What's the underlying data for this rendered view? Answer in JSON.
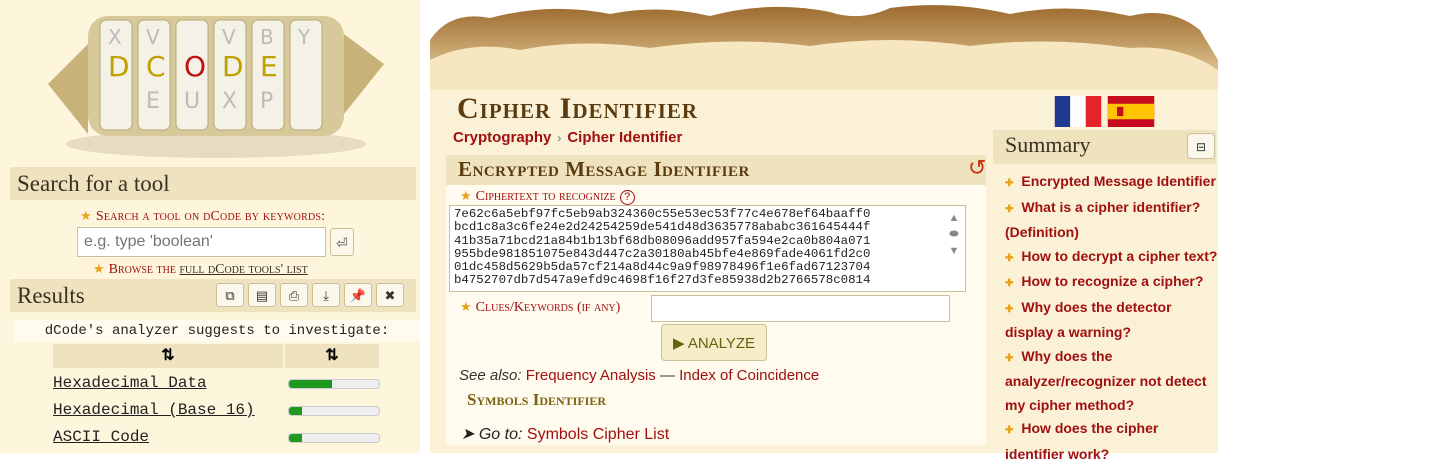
{
  "logo": {
    "text": "DCODE"
  },
  "sidebar": {
    "search_title": "Search for a tool",
    "search_label": "Search a tool on dCode by keywords:",
    "search_placeholder": "e.g. type 'boolean'",
    "browse_prefix": "Browse the",
    "browse_link": "full dCode tools' list",
    "results_title": "Results",
    "analyzer_note": "dCode's analyzer suggests to investigate:",
    "sort_a": "⇅",
    "sort_b": "⇅",
    "results": [
      {
        "name": "Hexadecimal Data",
        "score": 0.48
      },
      {
        "name": "Hexadecimal (Base 16)",
        "score": 0.14
      },
      {
        "name": "ASCII Code",
        "score": 0.14
      }
    ]
  },
  "page": {
    "title": "Cipher Identifier",
    "breadcrumb": [
      "Cryptography",
      "Cipher Identifier"
    ],
    "breadcrumb_sep": "›"
  },
  "tool": {
    "title": "Encrypted Message Identifier",
    "ciphertext_label": "Ciphertext to recognize",
    "ciphertext": "7e62c6a5ebf97fc5eb9ab324360c55e53ec53f77c4e678ef64baaff0\nbcd1c8a3c6fe24e2d24254259de541d48d3635778ababc361645444f\n41b35a71bcd21a84b1b13bf68db08096add957fa594e2ca0b804a071\n955bde981851075e843d447c2a30180ab45bfe4e869fade4061fd2c0\n01dc458d5629b5da57cf214a8d44c9a9f98978496f1e6fad67123704\nb4752707db7d547a9efd9c4698f16f27d3fe85938d2b2766578c0814",
    "clues_label": "Clues/Keywords (if any)",
    "analyze_label": "▶ ANALYZE",
    "see_also_label": "See also:",
    "see_also_links": [
      "Frequency Analysis",
      "Index of Coincidence"
    ],
    "see_also_sep": " — ",
    "symbols_title": "Symbols Identifier",
    "goto_label": "➤ Go to:",
    "goto_link": "Symbols Cipher List"
  },
  "summary": {
    "title": "Summary",
    "items": [
      "Encrypted Message Identifier",
      "What is a cipher identifier? (Definition)",
      "How to decrypt a cipher text?",
      "How to recognize a cipher?",
      "Why does the detector display a warning?",
      "Why does the analyzer/recognizer not detect my cipher method?",
      "How does the cipher identifier work?"
    ]
  },
  "colors": {
    "link": "#a01010",
    "panel": "#efe2bf",
    "bar": "#1f9a1f"
  },
  "icons": [
    "copy-icon",
    "copy-all-icon",
    "print-icon",
    "download-icon",
    "pin-icon",
    "close-icon",
    "reset-icon",
    "help-icon",
    "summary-toggle-icon"
  ]
}
